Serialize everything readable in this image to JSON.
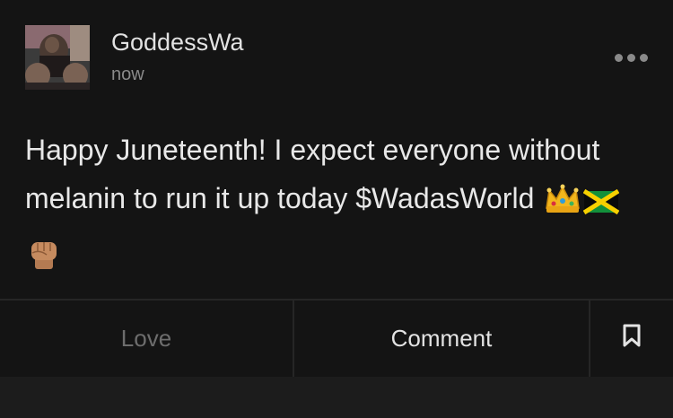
{
  "post": {
    "username": "GoddessWa",
    "timestamp": "now",
    "text": "Happy Juneteenth! I expect everyone without melanin to run it up today $WadasWorld",
    "emojis": [
      "crown-emoji",
      "jamaica-flag-emoji",
      "raised-fist-emoji"
    ],
    "more_icon": "more-dots-icon"
  },
  "actions": {
    "love_label": "Love",
    "comment_label": "Comment",
    "bookmark_icon": "bookmark-icon"
  },
  "colors": {
    "background": "#141414",
    "text_primary": "#e8e8e8",
    "text_muted": "#8a8a8a",
    "love_disabled": "#6d6d6d",
    "divider": "#262626"
  }
}
